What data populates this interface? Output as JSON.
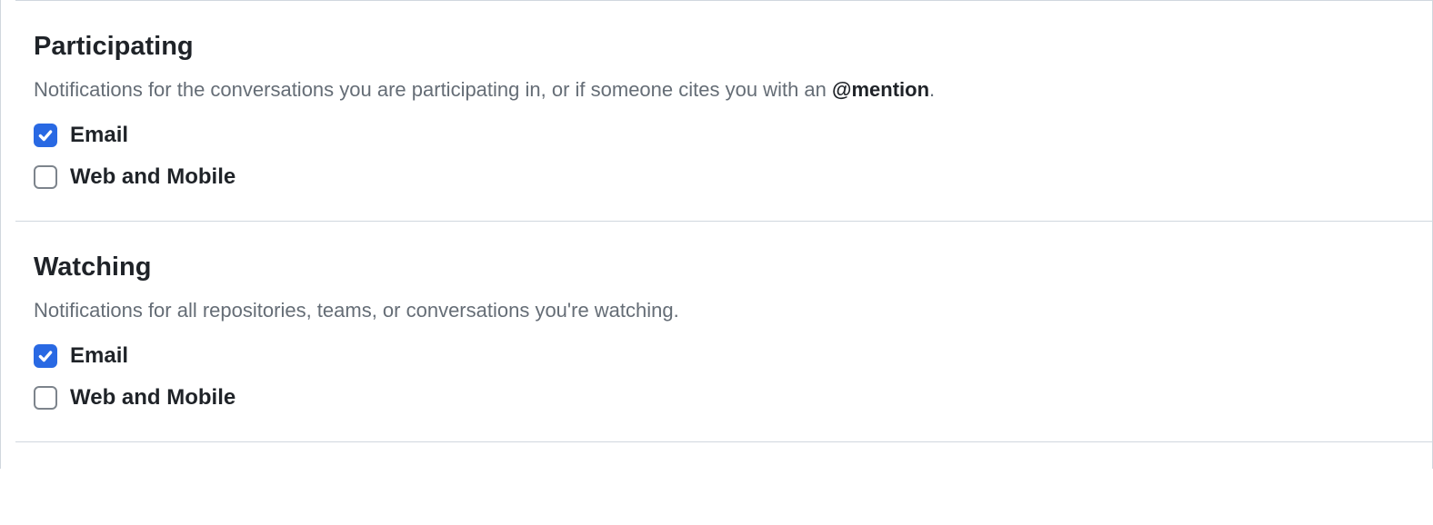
{
  "sections": [
    {
      "key": "participating",
      "title": "Participating",
      "description_pre": "Notifications for the conversations you are participating in, or if someone cites you with an ",
      "description_bold": "@mention",
      "description_post": ".",
      "options": [
        {
          "key": "email",
          "label": "Email",
          "checked": true
        },
        {
          "key": "web-mobile",
          "label": "Web and Mobile",
          "checked": false
        }
      ]
    },
    {
      "key": "watching",
      "title": "Watching",
      "description_pre": "Notifications for all repositories, teams, or conversations you're watching.",
      "description_bold": "",
      "description_post": "",
      "options": [
        {
          "key": "email",
          "label": "Email",
          "checked": true
        },
        {
          "key": "web-mobile",
          "label": "Web and Mobile",
          "checked": false
        }
      ]
    }
  ]
}
